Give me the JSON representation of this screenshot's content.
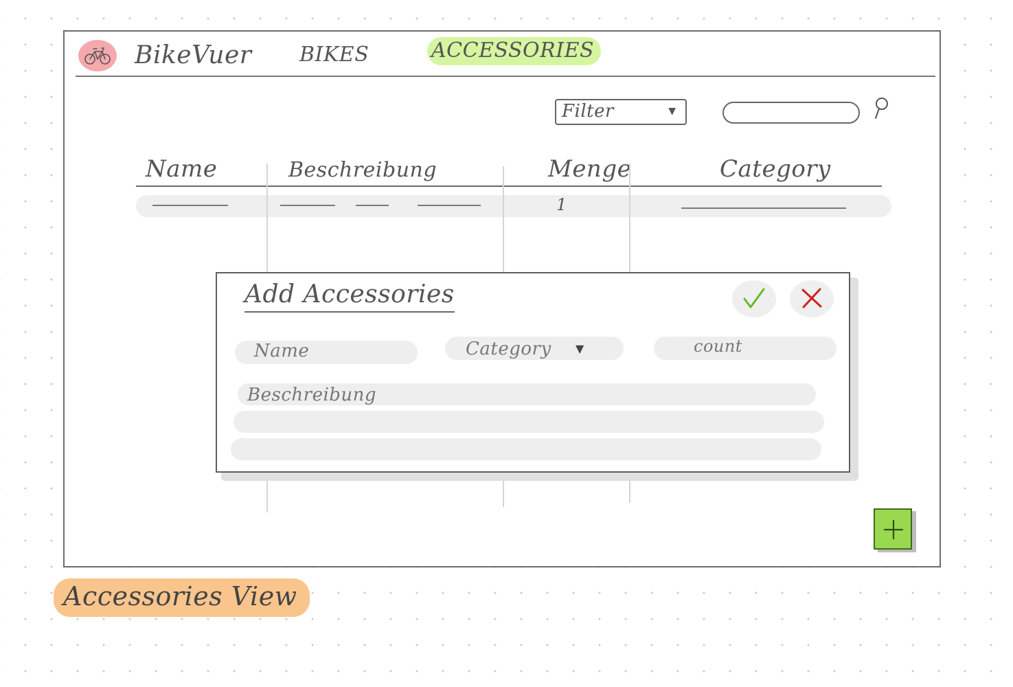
{
  "nav": {
    "app_name": "BikeVuer",
    "items": [
      {
        "label": "BIKES"
      },
      {
        "label": "ACCESSORIES",
        "active": true
      }
    ]
  },
  "toolbar": {
    "filter_label": "Filter",
    "search_placeholder": ""
  },
  "table": {
    "columns": [
      "Name",
      "Beschreibung",
      "Menge",
      "Category"
    ],
    "rows": [
      {
        "menge": "1"
      }
    ]
  },
  "dialog": {
    "title": "Add Accessories",
    "fields": {
      "name_placeholder": "Name",
      "category_placeholder": "Category",
      "count_placeholder": "count",
      "description_placeholder": "Beschreibung"
    }
  },
  "caption": "Accessories View",
  "colors": {
    "logo": "#f6a9ad",
    "nav_active": "#d6f5a0",
    "add_button": "#9ad84f",
    "confirm_check": "#6ab825",
    "cancel_x": "#cc2222",
    "caption": "#f9c58d"
  },
  "icons": {
    "logo": "bike-icon",
    "search": "search-icon",
    "confirm": "check-icon",
    "cancel": "close-icon",
    "add": "plus-icon"
  }
}
